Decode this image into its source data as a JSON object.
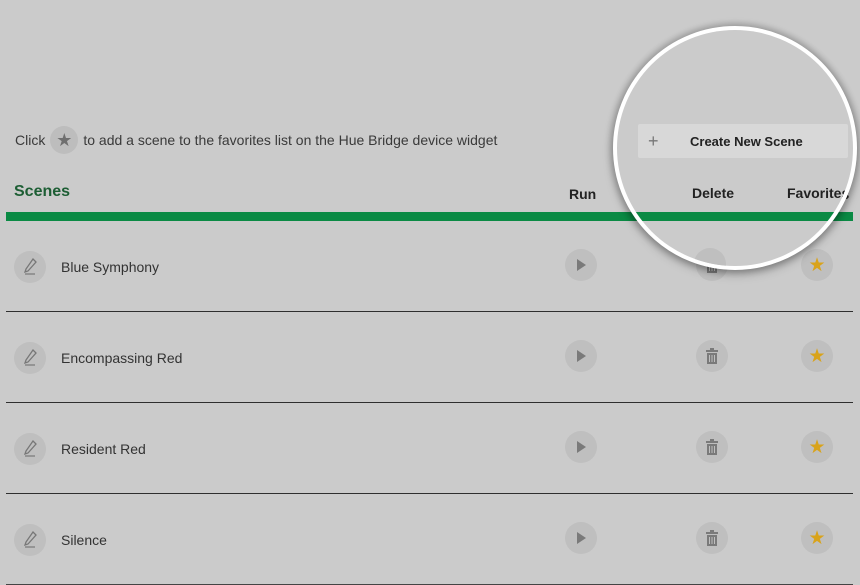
{
  "hint": {
    "prefix": "Click",
    "suffix": "to add a scene to the favorites list on the Hue Bridge device widget"
  },
  "header": {
    "scenes_title": "Scenes",
    "run": "Run",
    "delete": "Delete",
    "favorites": "Favorites"
  },
  "toolbar": {
    "create_label": "Create New Scene",
    "create_icon": "+"
  },
  "scenes": [
    {
      "name": "Blue Symphony",
      "favorite": true
    },
    {
      "name": "Encompassing Red",
      "favorite": true
    },
    {
      "name": "Resident Red",
      "favorite": true
    },
    {
      "name": "Silence",
      "favorite": true
    }
  ],
  "colors": {
    "background": "#cbcbcb",
    "accent_green": "#0a8a44",
    "title_green": "#1d5e34",
    "star_gold": "#d9a31a"
  },
  "icons": {
    "edit": "pencil-icon",
    "run": "play-icon",
    "delete": "trash-icon",
    "favorite": "star-icon",
    "create": "plus-icon"
  }
}
